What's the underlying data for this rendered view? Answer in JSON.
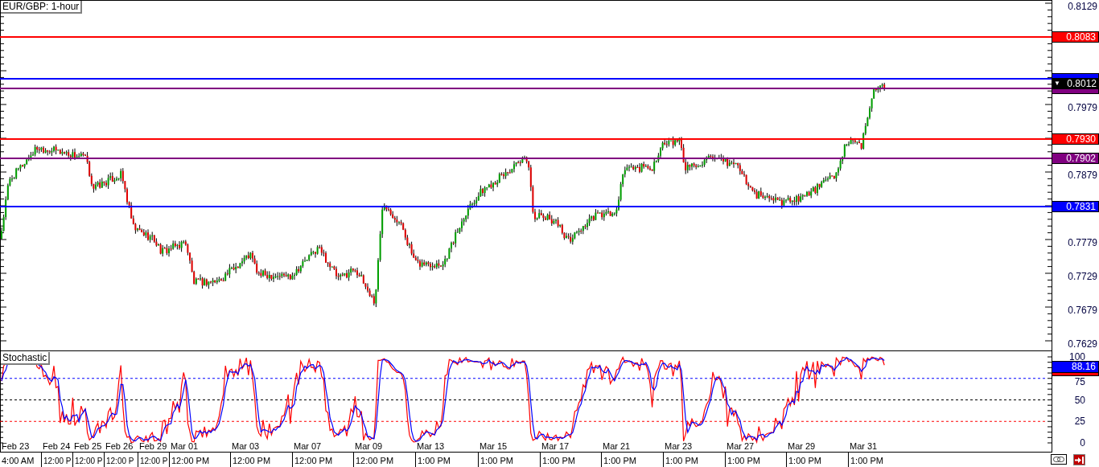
{
  "chart_title": "EUR/GBP: 1-hour",
  "price_axis": {
    "ticks": [
      "0.8129",
      "0.7979",
      "0.7879",
      "0.7779",
      "0.7729",
      "0.7679",
      "0.7629"
    ]
  },
  "levels": [
    {
      "color": "#ff0000",
      "label": "0.8083"
    },
    {
      "color": "#0000ff"
    },
    {
      "color": "#800080"
    },
    {
      "color": "#ff0000",
      "label": "0.7930"
    },
    {
      "color": "#800080",
      "label": "0.7902"
    },
    {
      "color": "#0000ff",
      "label": "0.7831"
    }
  ],
  "current_price": {
    "marker": "▼",
    "label": "0.8012"
  },
  "stochastic": {
    "title": "Stochastic",
    "ticks": [
      "100",
      "75",
      "50",
      "25",
      "0"
    ],
    "reading": "88.16"
  },
  "time_axis": {
    "dates": [
      "Feb 23",
      "Feb 24",
      "Feb 25",
      "Feb 26",
      "Feb 29",
      "Mar 01",
      "Mar 03",
      "Mar 07",
      "Mar 09",
      "Mar 13",
      "Mar 15",
      "Mar 17",
      "Mar 21",
      "Mar 23",
      "Mar 27",
      "Mar 29",
      "Mar 31"
    ],
    "times": [
      "4:00 AM",
      "12:00 P",
      "12:00 P",
      "12:00 P",
      "12:00 P",
      "12:00 PM",
      "12:00 PM",
      "12:00 PM",
      "12:00 PM",
      "1:00 PM",
      "1:00 PM",
      "1:00 PM",
      "1:00 PM",
      "1:00 PM",
      "1:00 PM",
      "1:00 PM",
      "1:00 PM"
    ]
  }
}
